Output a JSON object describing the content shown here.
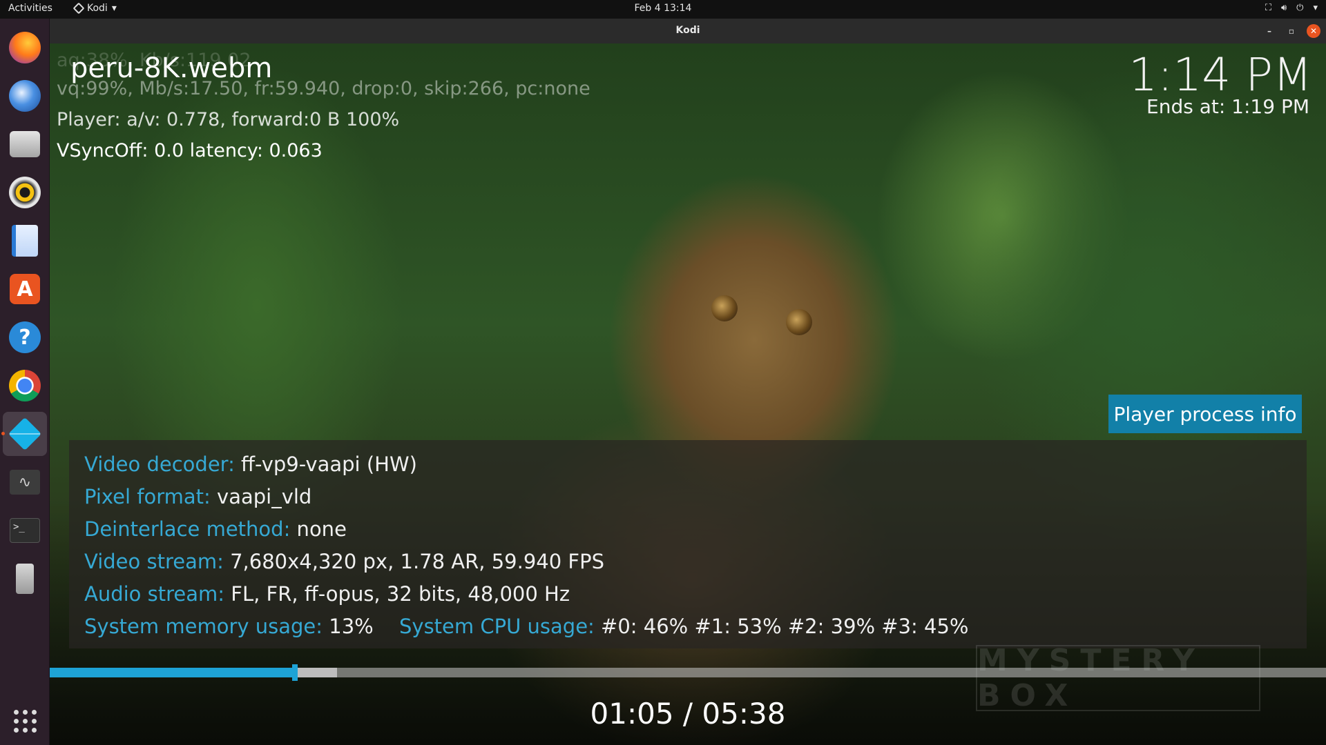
{
  "topbar": {
    "activities": "Activities",
    "app_menu": "Kodi",
    "clock": "Feb 4  13:14",
    "tray_icons": [
      "network-icon",
      "volume-icon",
      "power-icon",
      "chevron-down-icon"
    ]
  },
  "dock": {
    "items": [
      {
        "name": "firefox",
        "color": "#e66000"
      },
      {
        "name": "thunderbird",
        "color": "#2a6cc4"
      },
      {
        "name": "files",
        "color": "#9a9a9a"
      },
      {
        "name": "rhythmbox",
        "color": "#f5c211"
      },
      {
        "name": "libreoffice-writer",
        "color": "#2a7ad5"
      },
      {
        "name": "ubuntu-software",
        "color": "#e95420"
      },
      {
        "name": "help",
        "color": "#2a8ad8"
      },
      {
        "name": "chrome",
        "color": "#4285f4"
      },
      {
        "name": "kodi",
        "color": "#17b2e7"
      },
      {
        "name": "system-monitor",
        "color": "#3c3c3c"
      },
      {
        "name": "terminal",
        "color": "#2e2e2e"
      },
      {
        "name": "usb-drive",
        "color": "#bdbdbd"
      }
    ],
    "show_apps_icon": "grid-icon"
  },
  "window": {
    "title": "Kodi",
    "minimize": "–",
    "maximize": "▫",
    "close": "✕"
  },
  "overlay": {
    "debug_line_1": "aq:38%, Kb/s:119.02",
    "debug_line_2": "vq:99%, Mb/s:17.50, fr:59.940, drop:0, skip:266, pc:none",
    "debug_line_3": "Player: a/v: 0.778,  forward:0 B 100%",
    "debug_line_4": "VSyncOff: 0.0 latency: 0.063",
    "file_title": "peru-8K.webm",
    "clock": "1:14 PM",
    "ends_at": "Ends at: 1:19 PM"
  },
  "process_info": {
    "header": "Player process info",
    "rows": [
      {
        "key": "Video decoder:",
        "value": " ff-vp9-vaapi (HW)"
      },
      {
        "key": "Pixel format:",
        "value": " vaapi_vld"
      },
      {
        "key": "Deinterlace method:",
        "value": " none"
      },
      {
        "key": "Video stream:",
        "value": " 7,680x4,320 px, 1.78 AR, 59.940 FPS"
      },
      {
        "key": "Audio stream:",
        "value": " FL, FR, ff-opus, 32 bits, 48,000 Hz"
      }
    ],
    "memory_key": "System memory usage:",
    "memory_value": " 13%",
    "cpu_key": "System CPU usage:",
    "cpu_value": " #0:  46% #1:  53% #2:  39% #3:  45%"
  },
  "playback": {
    "elapsed": "01:05",
    "total": "05:38",
    "time_text": "01:05 / 05:38",
    "progress_fraction": 0.192,
    "cache_fraction": 0.225
  },
  "watermark": "MYSTERY BOX",
  "colors": {
    "kodi_blue": "#1280a8",
    "label_blue": "#36a9d4",
    "ubuntu_orange": "#e95420"
  }
}
